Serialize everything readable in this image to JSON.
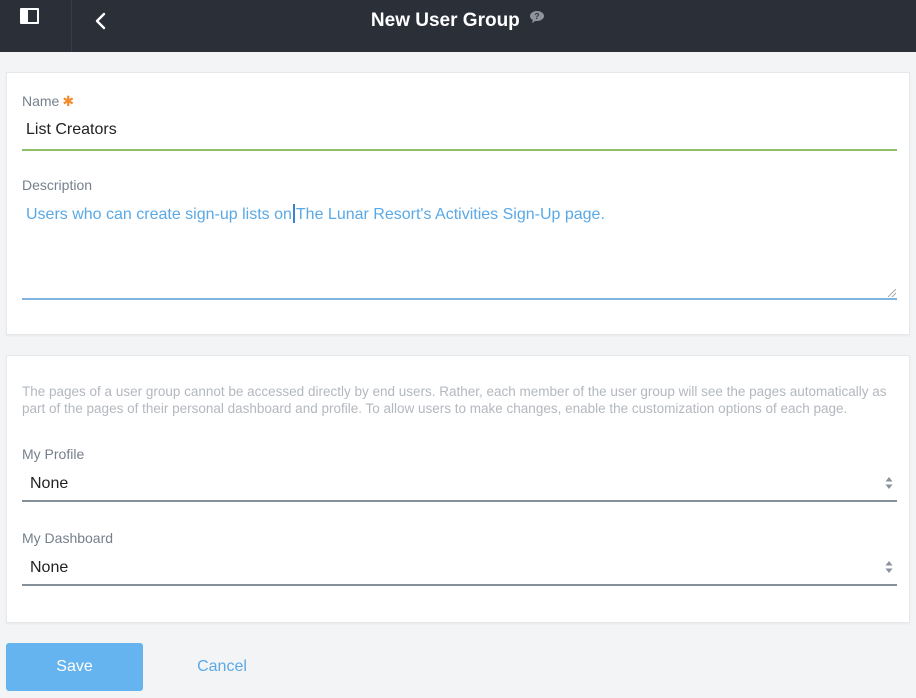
{
  "header": {
    "title": "New User Group",
    "back_icon": "chevron-left-icon",
    "sidebar_icon": "sidebar-toggle-icon",
    "help_icon": "speech-bubble-help-icon"
  },
  "form": {
    "name_label": "Name",
    "name_required_marker": "✱",
    "name_value": "List Creators",
    "description_label": "Description",
    "description_before_caret": "Users who can create sign-up lists on",
    "description_after_caret": "The Lunar Resort's Activities Sign-Up page."
  },
  "pages": {
    "info": "The pages of a user group cannot be accessed directly by end users. Rather, each member of the user group will see the pages automatically as part of the pages of their personal dashboard and profile. To allow users to make changes, enable the customization options of each page.",
    "my_profile_label": "My Profile",
    "my_profile_value": "None",
    "my_dashboard_label": "My Dashboard",
    "my_dashboard_value": "None"
  },
  "actions": {
    "save_label": "Save",
    "cancel_label": "Cancel"
  },
  "colors": {
    "header_bg": "#2b3038",
    "accent_blue": "#65b4ef",
    "valid_green": "#8fbf6a",
    "required_orange": "#f28a2e"
  }
}
